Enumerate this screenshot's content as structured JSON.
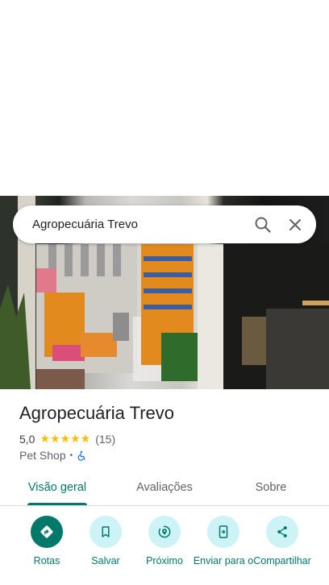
{
  "search": {
    "query": "Agropecuária Trevo"
  },
  "place": {
    "title": "Agropecuária Trevo",
    "rating": "5,0",
    "stars": "★★★★★",
    "reviews": "(15)",
    "category": "Pet Shop",
    "separator": "•"
  },
  "tabs": [
    {
      "label": "Visão geral",
      "active": true
    },
    {
      "label": "Avaliações",
      "active": false
    },
    {
      "label": "Sobre",
      "active": false
    }
  ],
  "actions": [
    {
      "label": "Rotas",
      "icon": "directions-icon"
    },
    {
      "label": "Salvar",
      "icon": "bookmark-icon"
    },
    {
      "label": "Próximo",
      "icon": "nearby-icon"
    },
    {
      "label": "Enviar para o",
      "icon": "send-to-phone-icon"
    },
    {
      "label": "Compartilhar",
      "icon": "share-icon"
    }
  ],
  "colors": {
    "accent": "#00796b",
    "action_bg": "#cdf3f6",
    "star": "#fbbc04"
  }
}
